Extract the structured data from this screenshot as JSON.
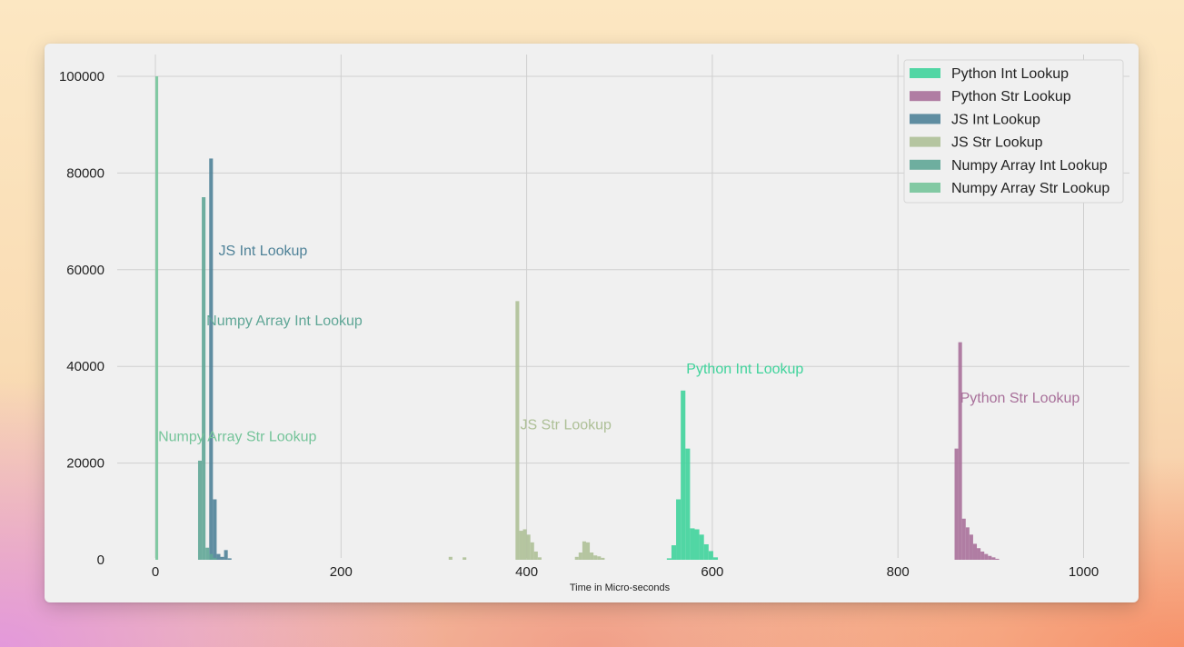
{
  "chart_data": {
    "type": "histogram",
    "title": "",
    "xlabel": "Time in Micro-seconds",
    "ylabel": "",
    "xlim": [
      -30,
      1045
    ],
    "ylim": [
      0,
      105000
    ],
    "xticks": [
      0,
      200,
      400,
      600,
      800,
      1000
    ],
    "yticks": [
      0,
      20000,
      40000,
      60000,
      80000,
      100000
    ],
    "grid": true,
    "legend_position": "top-right",
    "series": [
      {
        "name": "Python Int Lookup",
        "color": "#3fd39b",
        "label": "Python Int Lookup",
        "label_at": [
          572,
          38500
        ],
        "bins": [
          [
            551,
            556,
            300
          ],
          [
            556,
            561,
            3000
          ],
          [
            561,
            566,
            12500
          ],
          [
            566,
            571,
            35000
          ],
          [
            571,
            576,
            23000
          ],
          [
            576,
            581,
            6500
          ],
          [
            581,
            586,
            6300
          ],
          [
            586,
            591,
            5200
          ],
          [
            591,
            596,
            3200
          ],
          [
            596,
            601,
            1800
          ],
          [
            601,
            606,
            500
          ]
        ]
      },
      {
        "name": "Python Str Lookup",
        "color": "#a8709a",
        "label": "Python Str Lookup",
        "label_at": [
          867,
          32500
        ],
        "bins": [
          [
            861,
            865,
            23000
          ],
          [
            865,
            869,
            45000
          ],
          [
            869,
            873,
            8500
          ],
          [
            873,
            877,
            6700
          ],
          [
            877,
            881,
            5200
          ],
          [
            881,
            885,
            3300
          ],
          [
            885,
            889,
            2400
          ],
          [
            889,
            893,
            1700
          ],
          [
            893,
            897,
            1200
          ],
          [
            897,
            901,
            800
          ],
          [
            901,
            905,
            500
          ],
          [
            905,
            909,
            200
          ]
        ]
      },
      {
        "name": "JS Int Lookup",
        "color": "#4f8298",
        "label": "JS Int Lookup",
        "label_at": [
          68,
          63000
        ],
        "bins": [
          [
            58,
            62,
            83000
          ],
          [
            62,
            66,
            12500
          ],
          [
            66,
            70,
            1200
          ],
          [
            70,
            74,
            600
          ],
          [
            74,
            78,
            2000
          ],
          [
            78,
            82,
            300
          ]
        ]
      },
      {
        "name": "JS Str Lookup",
        "color": "#aec097",
        "label": "JS Str Lookup",
        "label_at": [
          393,
          27000
        ],
        "bins": [
          [
            316,
            320,
            600
          ],
          [
            331,
            335,
            500
          ],
          [
            388,
            392,
            53500
          ],
          [
            392,
            396,
            6000
          ],
          [
            396,
            400,
            6300
          ],
          [
            400,
            404,
            5200
          ],
          [
            404,
            408,
            3600
          ],
          [
            408,
            412,
            1700
          ],
          [
            412,
            416,
            500
          ],
          [
            452,
            456,
            600
          ],
          [
            456,
            460,
            1500
          ],
          [
            460,
            464,
            3800
          ],
          [
            464,
            468,
            3600
          ],
          [
            468,
            472,
            1500
          ],
          [
            472,
            476,
            900
          ],
          [
            476,
            480,
            700
          ],
          [
            480,
            484,
            400
          ]
        ]
      },
      {
        "name": "Numpy Array Int Lookup",
        "color": "#5fa696",
        "label": "Numpy Array Int Lookup",
        "label_at": [
          55,
          48500
        ],
        "bins": [
          [
            46,
            50,
            20500
          ],
          [
            50,
            54,
            75000
          ],
          [
            54,
            58,
            2500
          ],
          [
            58,
            62,
            1200
          ],
          [
            62,
            66,
            400
          ]
        ]
      },
      {
        "name": "Numpy Array Str Lookup",
        "color": "#75c49a",
        "label": "Numpy Array Str Lookup",
        "label_at": [
          3,
          24500
        ],
        "bins": [
          [
            0,
            3,
            100000
          ]
        ]
      }
    ]
  },
  "legend_swatch_colors": [
    "#3fd39b",
    "#a8709a",
    "#4f8298",
    "#aec097",
    "#5fa696",
    "#75c49a"
  ]
}
